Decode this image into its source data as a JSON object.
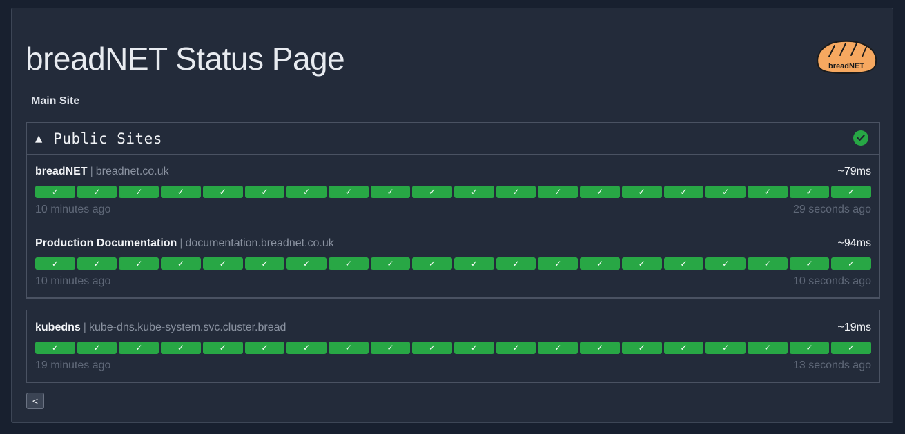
{
  "page": {
    "title": "breadNET Status Page",
    "logo_text": "breadNET",
    "main_site_link": "Main Site",
    "back_button": "<"
  },
  "colors": {
    "background": "#18202f",
    "panel": "#232b3a",
    "status_green": "#28a745",
    "logo_orange": "#f6a860"
  },
  "groups": [
    {
      "caret": "▲",
      "name": "Public Sites",
      "status_icon": "check-circle-icon",
      "monitors": [
        {
          "name": "breadNET",
          "separator": "|",
          "url": "breadnet.co.uk",
          "latency": "~79ms",
          "checks": [
            "✓",
            "✓",
            "✓",
            "✓",
            "✓",
            "✓",
            "✓",
            "✓",
            "✓",
            "✓",
            "✓",
            "✓",
            "✓",
            "✓",
            "✓",
            "✓",
            "✓",
            "✓",
            "✓",
            "✓"
          ],
          "oldest": "10 minutes ago",
          "newest": "29 seconds ago"
        },
        {
          "name": "Production Documentation",
          "separator": "|",
          "url": "documentation.breadnet.co.uk",
          "latency": "~94ms",
          "checks": [
            "✓",
            "✓",
            "✓",
            "✓",
            "✓",
            "✓",
            "✓",
            "✓",
            "✓",
            "✓",
            "✓",
            "✓",
            "✓",
            "✓",
            "✓",
            "✓",
            "✓",
            "✓",
            "✓",
            "✓"
          ],
          "oldest": "10 minutes ago",
          "newest": "10 seconds ago"
        }
      ]
    }
  ],
  "standalone_monitors": [
    {
      "name": "kubedns",
      "separator": "|",
      "url": "kube-dns.kube-system.svc.cluster.bread",
      "latency": "~19ms",
      "checks": [
        "✓",
        "✓",
        "✓",
        "✓",
        "✓",
        "✓",
        "✓",
        "✓",
        "✓",
        "✓",
        "✓",
        "✓",
        "✓",
        "✓",
        "✓",
        "✓",
        "✓",
        "✓",
        "✓",
        "✓"
      ],
      "oldest": "19 minutes ago",
      "newest": "13 seconds ago"
    }
  ]
}
